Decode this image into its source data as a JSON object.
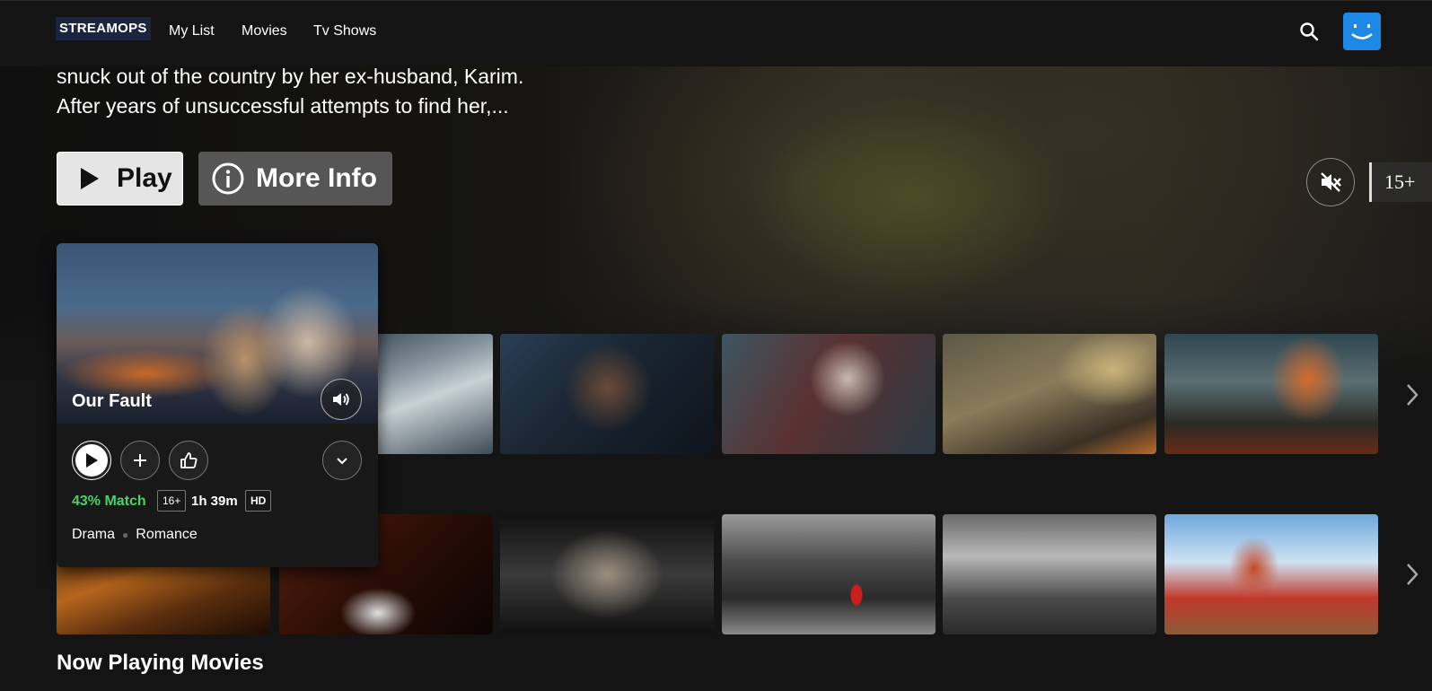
{
  "nav": {
    "logo": "STREAMOPS",
    "links": [
      "My List",
      "Movies",
      "Tv Shows"
    ]
  },
  "hero": {
    "synopsis_line1": "snuck out of the country by her ex-husband, Karim.",
    "synopsis_line2": "After years of unsuccessful attempts to find her,...",
    "play_label": "Play",
    "more_info_label": "More Info",
    "maturity_rating": "15+"
  },
  "hover_card": {
    "title": "Our Fault",
    "match": "43% Match",
    "age_badge": "16+",
    "runtime": "1h 39m",
    "quality_badge": "HD",
    "genres": [
      "Drama",
      "Romance"
    ]
  },
  "rows": {
    "row1_tiles": [
      "pirate-thumbnail",
      "man-with-glasses-thumbnail",
      "bald-men-thumbnail",
      "couple-action-thumbnail",
      "woman-fire-forest-thumbnail"
    ],
    "row2_tiles": [
      "rain-prisoner-thumbnail",
      "man-in-tuxedo-thumbnail",
      "crime-family-poster-thumbnail",
      "girl-red-coat-thumbnail",
      "jury-room-thumbnail",
      "anime-bathhouse-thumbnail"
    ]
  },
  "section_title": "Now Playing Movies",
  "colors": {
    "background": "#141414",
    "match_green": "#46d369",
    "avatar_blue": "#1e88e5"
  }
}
